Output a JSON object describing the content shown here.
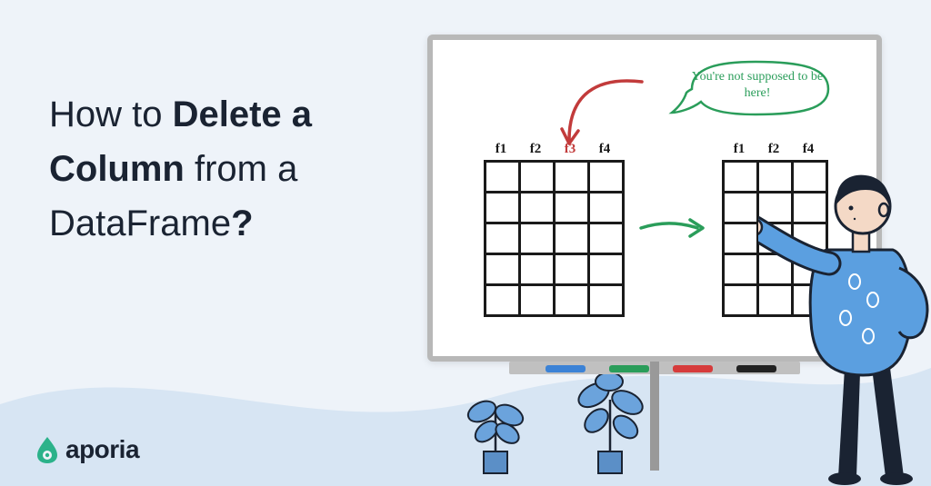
{
  "title": {
    "part1": "How to ",
    "bold": "Delete a Column",
    "part2": " from a DataFrame",
    "qmark": "?"
  },
  "logo": {
    "text": "aporia"
  },
  "board": {
    "speech": "You're not supposed to be here!",
    "left_headers": [
      "f1",
      "f2",
      "f3",
      "f4"
    ],
    "right_headers": [
      "f1",
      "f2",
      "f4"
    ],
    "bad_column": "f3"
  },
  "colors": {
    "bg": "#eef3f9",
    "wave": "#d7e5f3",
    "accent_green": "#2a9d5a",
    "accent_red": "#c23b3b",
    "text": "#1a2332"
  }
}
